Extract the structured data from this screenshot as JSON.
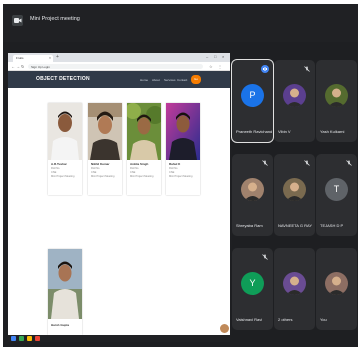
{
  "meet": {
    "title": "Mini Project meeting"
  },
  "presentation": {
    "browser_tab": "Fruits",
    "url": "Sign Up Login",
    "site_title": "OBJECT DETECTION",
    "nav": [
      "Home",
      "About",
      "Services",
      "Contact"
    ],
    "nav_button": "Go",
    "cards": [
      {
        "name": "A.R.Tushar",
        "lines": [
          "Roll No",
          "CSE",
          "Mini Project Meeting"
        ]
      },
      {
        "name": "Nikhil Kumar",
        "lines": [
          "Roll No",
          "CSE",
          "Mini Project Meeting"
        ]
      },
      {
        "name": "Ankita Singh",
        "lines": [
          "Roll No",
          "CSE",
          "Mini Project Meeting"
        ]
      },
      {
        "name": "Rahul K",
        "lines": [
          "Roll No",
          "CSE",
          "Mini Project Meeting"
        ]
      },
      {
        "name": "Harsh Gupta",
        "lines": []
      }
    ]
  },
  "participants": [
    {
      "name": "Praneeth Ravichandra",
      "initial": "P",
      "avatar_color": "#1a73e8",
      "type": "letter",
      "active": true,
      "badge": "speaking"
    },
    {
      "name": "Vibin V",
      "initial": "",
      "avatar_color": "#5b3f8f",
      "type": "photo",
      "active": false,
      "badge": "muted"
    },
    {
      "name": "Yash Kulkarni",
      "initial": "",
      "avatar_color": "#556b2f",
      "type": "photo",
      "active": false,
      "badge": "none"
    },
    {
      "name": "Shreyaba Ram",
      "initial": "",
      "avatar_color": "#a0826d",
      "type": "photo",
      "active": false,
      "badge": "muted"
    },
    {
      "name": "NAVNEETA G RAY",
      "initial": "",
      "avatar_color": "#7a6a4f",
      "type": "photo",
      "active": false,
      "badge": "muted"
    },
    {
      "name": "TEJASH D P",
      "initial": "T",
      "avatar_color": "#5f6368",
      "type": "letter",
      "active": false,
      "badge": "muted"
    },
    {
      "name": "Vaishnavi Ravi",
      "initial": "Y",
      "avatar_color": "#0f9d58",
      "type": "letter",
      "active": false,
      "badge": "muted"
    },
    {
      "name": "2 others",
      "initial": "",
      "avatar_color": "#6a4c93",
      "type": "photo",
      "active": false,
      "badge": "none"
    },
    {
      "name": "You",
      "initial": "",
      "avatar_color": "#8d6e63",
      "type": "photo",
      "active": false,
      "badge": "none"
    }
  ],
  "colors": {
    "meet_background": "#1e1f22",
    "tile_background": "#2d2e31",
    "site_header": "#303a48",
    "accent_button": "#f57c00"
  }
}
